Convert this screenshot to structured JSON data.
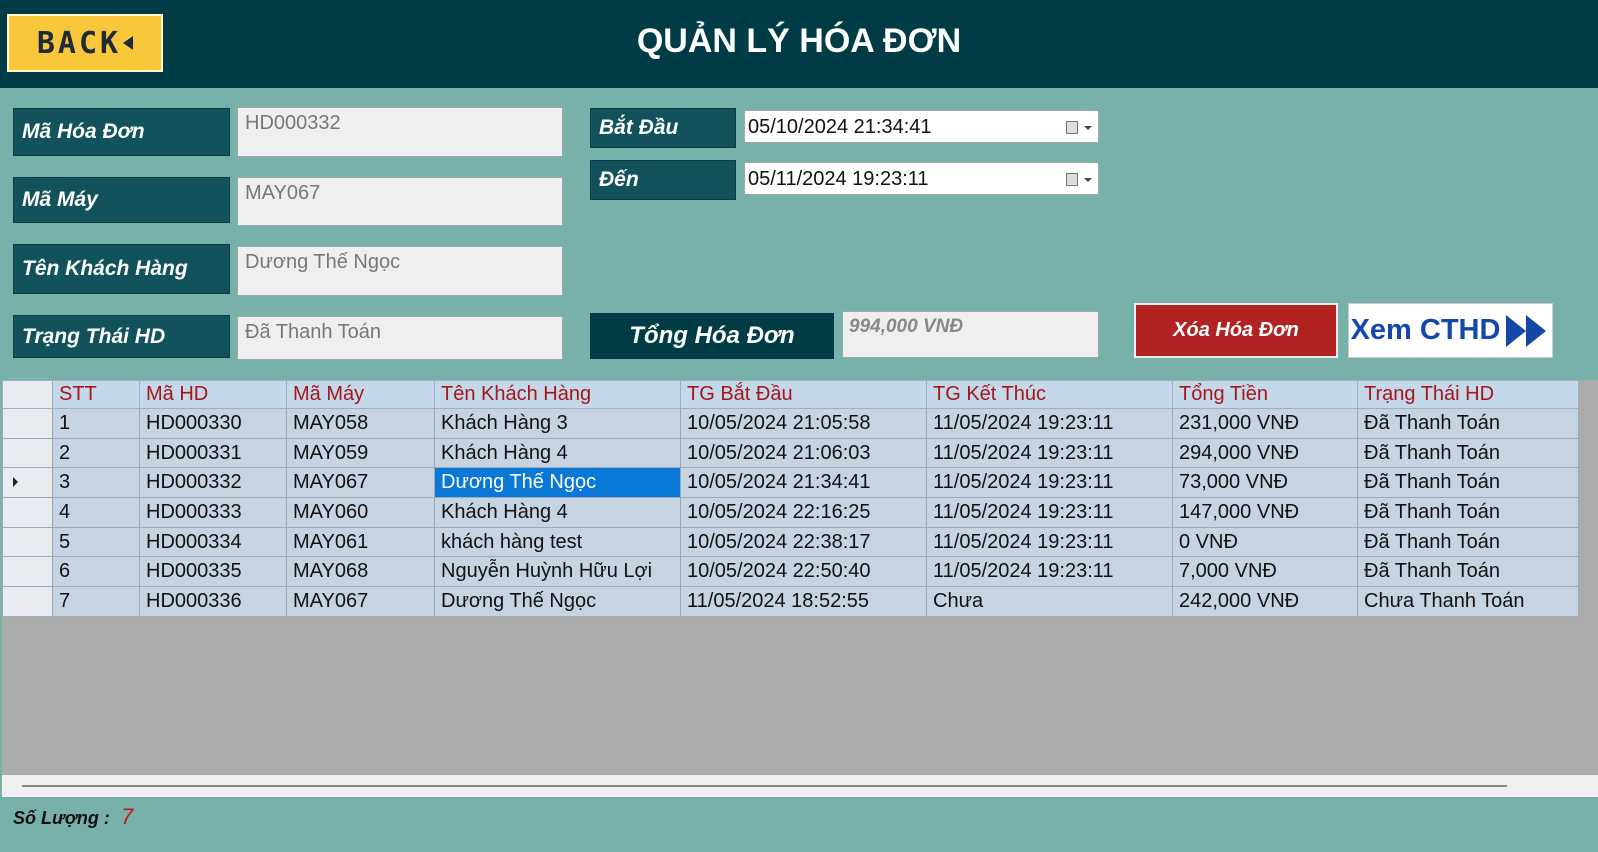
{
  "header": {
    "back_label": "BACK",
    "title": "QUẢN LÝ HÓA ĐƠN"
  },
  "form": {
    "ma_hoa_don_label": "Mã Hóa Đơn",
    "ma_hoa_don_value": "HD000332",
    "ma_may_label": "Mã Máy",
    "ma_may_value": "MAY067",
    "ten_khach_hang_label": "Tên Khách Hàng",
    "ten_khach_hang_value": "Dương Thế Ngọc",
    "trang_thai_label": "Trạng Thái HD",
    "trang_thai_value": "Đã Thanh Toán",
    "bat_dau_label": "Bắt Đầu",
    "bat_dau_value": "05/10/2024 21:34:41",
    "den_label": "Đến",
    "den_value": "05/11/2024 19:23:11",
    "tong_hoa_don_label": "Tổng Hóa Đơn",
    "tong_hoa_don_value": "994,000 VNĐ"
  },
  "buttons": {
    "delete_label": "Xóa Hóa Đơn",
    "view_label": "Xem CTHD"
  },
  "table": {
    "columns": [
      "STT",
      "Mã HD",
      "Mã Máy",
      "Tên Khách Hàng",
      "TG Bắt Đầu",
      "TG Kết Thúc",
      "Tổng Tiền",
      "Trạng Thái HD"
    ],
    "rows": [
      [
        "1",
        "HD000330",
        "MAY058",
        "Khách Hàng 3",
        "10/05/2024 21:05:58",
        "11/05/2024 19:23:11",
        "231,000 VNĐ",
        "Đã Thanh Toán"
      ],
      [
        "2",
        "HD000331",
        "MAY059",
        "Khách Hàng 4",
        "10/05/2024 21:06:03",
        "11/05/2024 19:23:11",
        "294,000 VNĐ",
        "Đã Thanh Toán"
      ],
      [
        "3",
        "HD000332",
        "MAY067",
        "Dương Thế Ngọc",
        "10/05/2024 21:34:41",
        "11/05/2024 19:23:11",
        "73,000 VNĐ",
        "Đã Thanh Toán"
      ],
      [
        "4",
        "HD000333",
        "MAY060",
        "Khách Hàng 4",
        "10/05/2024 22:16:25",
        "11/05/2024 19:23:11",
        "147,000 VNĐ",
        "Đã Thanh Toán"
      ],
      [
        "5",
        "HD000334",
        "MAY061",
        "khách hàng test",
        "10/05/2024 22:38:17",
        "11/05/2024 19:23:11",
        "0 VNĐ",
        "Đã Thanh Toán"
      ],
      [
        "6",
        "HD000335",
        "MAY068",
        "Nguyễn Huỳnh Hữu Lợi",
        "10/05/2024 22:50:40",
        "11/05/2024 19:23:11",
        "7,000 VNĐ",
        "Đã Thanh Toán"
      ],
      [
        "7",
        "HD000336",
        "MAY067",
        "Dương Thế Ngọc",
        "11/05/2024 18:52:55",
        "Chưa",
        "242,000 VNĐ",
        "Chưa Thanh Toán"
      ]
    ],
    "selected_row": 2,
    "selected_col": 3
  },
  "footer": {
    "count_label": "Số Lượng :",
    "count_value": "7"
  },
  "colors": {
    "header_bg": "#003c45",
    "body_bg": "#78b1a9",
    "back_btn": "#f9c83a",
    "delete_btn": "#b22222",
    "view_btn_text": "#1448a8",
    "selection": "#0a78d6",
    "column_header_text": "#a4161a"
  },
  "icons": {
    "back": "triangle-left-icon",
    "view": "double-chevron-right-icon",
    "calendar": "calendar-icon"
  }
}
